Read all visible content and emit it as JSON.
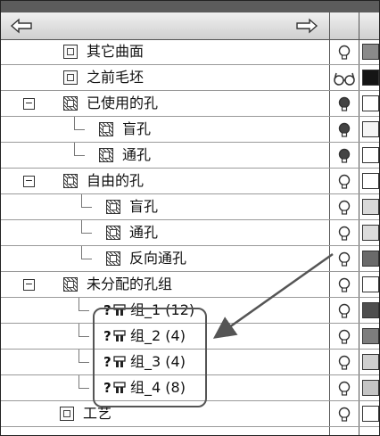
{
  "header": {
    "back_icon": "left-arrow-icon",
    "forward_icon": "right-arrow-icon"
  },
  "tree": {
    "rows": [
      {
        "key": "other-surfaces",
        "label": "其它曲面",
        "icon": "surface-icon",
        "visibility": "lightbulb-off-icon",
        "swatch": "#8a8a8a"
      },
      {
        "key": "previous-blank",
        "label": "之前毛坯",
        "icon": "blank-icon",
        "visibility": "glasses-icon",
        "swatch": "#151515"
      },
      {
        "key": "used-holes",
        "label": "已使用的孔",
        "icon": "hole-feature-icon",
        "visibility": "lightbulb-on-icon",
        "swatch": "#ffffff",
        "expander": "−"
      },
      {
        "key": "used-blind-hole",
        "label": "盲孔",
        "icon": "blind-hole-icon",
        "visibility": "lightbulb-on-icon",
        "swatch": "#f5f5f5"
      },
      {
        "key": "used-through-hole",
        "label": "通孔",
        "icon": "through-hole-icon",
        "visibility": "lightbulb-on-icon",
        "swatch": "#ffffff"
      },
      {
        "key": "free-holes",
        "label": "自由的孔",
        "icon": "hole-feature-icon",
        "visibility": "lightbulb-off-icon",
        "swatch": "#ffffff",
        "expander": "−"
      },
      {
        "key": "free-blind-hole",
        "label": "盲孔",
        "icon": "blind-hole-icon",
        "visibility": "lightbulb-off-icon",
        "swatch": "#d9d9d9"
      },
      {
        "key": "free-through-hole",
        "label": "通孔",
        "icon": "through-hole-icon",
        "visibility": "lightbulb-off-icon",
        "swatch": "#dcdcdc"
      },
      {
        "key": "free-reverse-through-hole",
        "label": "反向通孔",
        "icon": "reverse-through-hole-icon",
        "visibility": "lightbulb-off-icon",
        "swatch": "#6a6a6a"
      },
      {
        "key": "unassigned-hole-groups",
        "label": "未分配的孔组",
        "icon": "hole-group-folder-icon",
        "visibility": "lightbulb-off-icon",
        "swatch": "#ffffff",
        "expander": "−"
      },
      {
        "key": "group-1",
        "label": "组_1 (12)",
        "icon": "unknown-hole-group-icon",
        "visibility": "lightbulb-off-icon",
        "swatch": "#4e4e4e"
      },
      {
        "key": "group-2",
        "label": "组_2 (4)",
        "icon": "unknown-hole-group-icon",
        "visibility": "lightbulb-off-icon",
        "swatch": "#7d7d7d"
      },
      {
        "key": "group-3",
        "label": "组_3 (4)",
        "icon": "unknown-hole-group-icon",
        "visibility": "lightbulb-off-icon",
        "swatch": "#cfcfcf"
      },
      {
        "key": "group-4",
        "label": "组_4 (8)",
        "icon": "unknown-hole-group-icon",
        "visibility": "lightbulb-off-icon",
        "swatch": "#c4c4c4"
      },
      {
        "key": "process",
        "label": "工艺",
        "icon": "process-icon",
        "visibility": "lightbulb-off-icon",
        "swatch": "#ffffff"
      }
    ]
  },
  "annotation": {
    "callout_color": "#555555",
    "arrow_color": "#555555"
  }
}
